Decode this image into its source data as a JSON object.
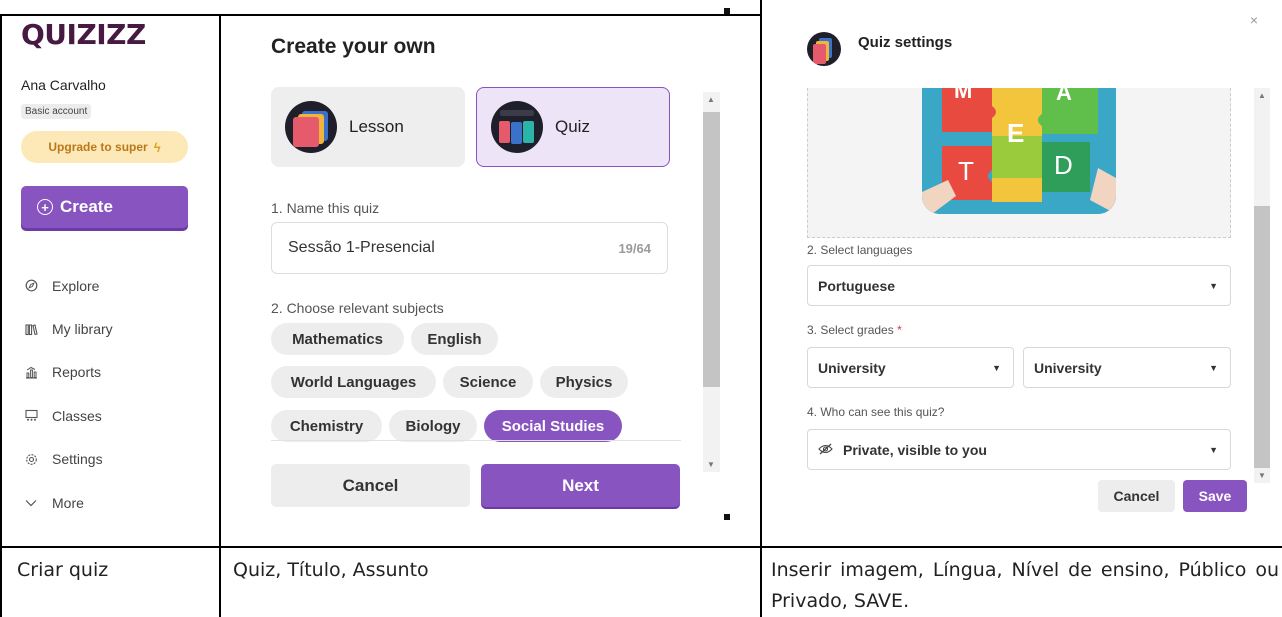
{
  "sidebar": {
    "logo": "QUIZIZZ",
    "user_name": "Ana Carvalho",
    "plan": "Basic account",
    "upgrade_label": "Upgrade to super",
    "create_label": "Create",
    "nav": [
      {
        "label": "Explore",
        "icon": "compass-icon"
      },
      {
        "label": "My library",
        "icon": "library-icon"
      },
      {
        "label": "Reports",
        "icon": "reports-icon"
      },
      {
        "label": "Classes",
        "icon": "classes-icon"
      },
      {
        "label": "Settings",
        "icon": "gear-icon"
      },
      {
        "label": "More",
        "icon": "chevron-down-icon"
      }
    ]
  },
  "create_panel": {
    "title": "Create your own",
    "types": {
      "lesson": "Lesson",
      "quiz": "Quiz"
    },
    "selected_type": "Quiz",
    "name_label": "1. Name this quiz",
    "name_value": "Sessão 1-Presencial",
    "name_count": "19/64",
    "subjects_label": "2. Choose relevant subjects",
    "subjects": [
      "Mathematics",
      "English",
      "World Languages",
      "Science",
      "Physics",
      "Chemistry",
      "Biology",
      "Social Studies"
    ],
    "selected_subject": "Social Studies",
    "cancel_label": "Cancel",
    "next_label": "Next"
  },
  "settings_panel": {
    "title": "Quiz settings",
    "image_letters": [
      "M",
      "A",
      "E",
      "T",
      "D"
    ],
    "languages_label": "2. Select languages",
    "language_value": "Portuguese",
    "grades_label": "3. Select grades",
    "grades_required_mark": "*",
    "grade_from": "University",
    "grade_to": "University",
    "visibility_label": "4. Who can see this quiz?",
    "visibility_value": "Private, visible to you",
    "cancel_label": "Cancel",
    "save_label": "Save"
  },
  "captions": {
    "col1": "Criar quiz",
    "col2": "Quiz, Título, Assunto",
    "col3": "Inserir imagem, Língua, Nível de ensino, Público ou Privado, SAVE."
  },
  "colors": {
    "accent": "#8854c0",
    "upgrade_bg": "#fde9b8",
    "logo": "#461a42"
  }
}
